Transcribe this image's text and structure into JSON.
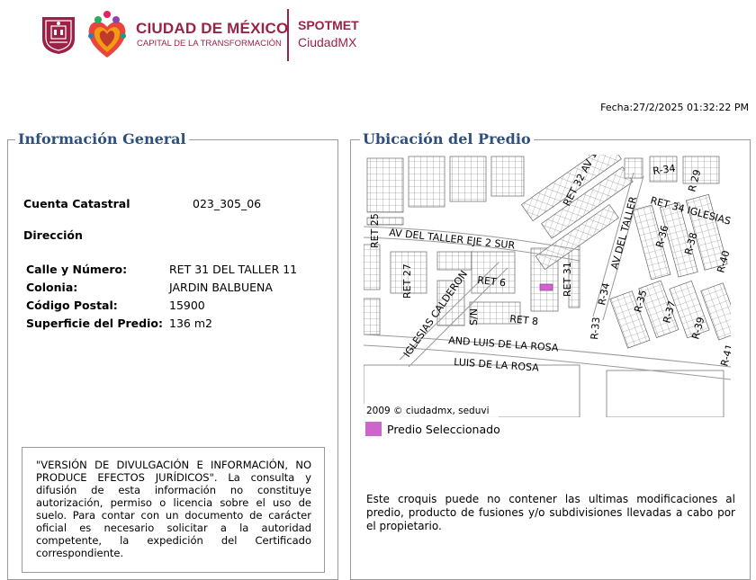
{
  "header": {
    "brand_title": "CIUDAD DE MÉXICO",
    "brand_subtitle": "CAPITAL DE LA TRANSFORMACIÓN",
    "app_title": "SPOTMET",
    "app_subtitle": "CiudadMX",
    "colors": {
      "brand": "#9b2247"
    }
  },
  "fecha": "Fecha:27/2/2025 01:32:22 PM",
  "general": {
    "legend": "Información General",
    "cuenta_label": "Cuenta Catastral",
    "cuenta_value": "023_305_06",
    "direccion_label": "Dirección",
    "fields": [
      {
        "label": "Calle y Número:",
        "value": "RET 31 DEL TALLER 11"
      },
      {
        "label": "Colonia:",
        "value": "JARDIN BALBUENA"
      },
      {
        "label": "Código Postal:",
        "value": "15900"
      },
      {
        "label": "Superficie del Predio:",
        "value": "136 m2"
      }
    ],
    "disclaimer": "\"VERSIÓN DE DIVULGACIÓN E INFORMACIÓN, NO PRODUCE EFECTOS JURÍDICOS\". La consulta y difusión de esta información no constituye autorización, permiso o licencia sobre el uso de suelo. Para contar con un documento de carácter oficial es necesario solicitar a la autoridad competente, la expedición del Certificado correspondiente."
  },
  "ubicacion": {
    "legend": "Ubicación del Predio",
    "map_credit": "2009 © ciudadmx, seduvi",
    "street_labels": [
      "R-34",
      "R 29",
      "RET 32 AV 1",
      "RET 34 IGLESIAS",
      "RET 25",
      "AV DEL TALLER EJE 2 SUR",
      "AV DEL TALLER",
      "R-36",
      "R-38",
      "R-40",
      "RET 27",
      "RET 6",
      "RET 31",
      "R-34",
      "R-35",
      "R-37",
      "R-39",
      "R-41",
      "IGLESIAS CALDERON",
      "S/N",
      "RET 8",
      "R-33",
      "AND LUIS DE LA ROSA",
      "LUIS DE LA ROSA"
    ],
    "legend_label": "Predio Seleccionado",
    "legend_color": "#cc66cc",
    "note": "Este croquis puede no contener las ultimas modificaciones al predio, producto de fusiones y/o subdivisiones llevadas a cabo por el propietario."
  }
}
